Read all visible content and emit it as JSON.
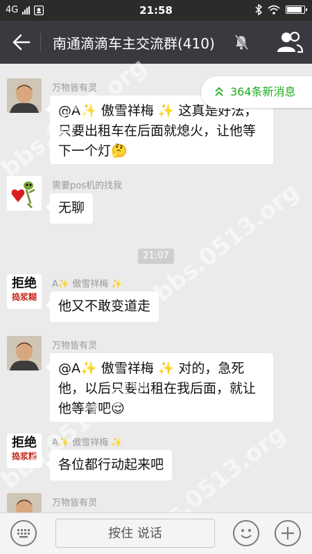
{
  "status_bar": {
    "network": "4G",
    "time": "21:58",
    "battery_level": 0.9
  },
  "header": {
    "title": "南通滴滴车主交流群(410)"
  },
  "new_messages": {
    "label": "364条新消息"
  },
  "messages": [
    {
      "sender": "万物皆有灵",
      "avatar": "man-photo",
      "text": "@A✨ 傲雪祥梅 ✨ 这真是好法，只要出租车在后面就熄火，让他等下一个灯🤔"
    },
    {
      "sender": "需要pos机的找我",
      "avatar": "rose-figure",
      "text": "无聊"
    },
    {
      "time_divider": "21:07"
    },
    {
      "sender": "A✨ 傲雪祥梅 ✨",
      "avatar": "reject-sticker",
      "text": "他又不敢变道走"
    },
    {
      "sender": "万物皆有灵",
      "avatar": "man-photo",
      "text": "@A✨ 傲雪祥梅 ✨ 对的，急死他，以后只要出租在我后面，就让他等着吧😌"
    },
    {
      "sender": "A✨ 傲雪祥梅 ✨",
      "avatar": "reject-sticker",
      "text": "各位都行动起来吧"
    },
    {
      "sender": "万物皆有灵",
      "avatar": "man-photo"
    }
  ],
  "avatar_text": {
    "reject_top": "拒绝",
    "reject_bottom": "捣浆糊"
  },
  "input_bar": {
    "hold_to_talk": "按住 说话"
  },
  "watermark": "bbs.0513.org",
  "colors": {
    "header_bg": "#393a3f",
    "chat_bg": "#ebebeb",
    "accent_green": "#1aad19"
  }
}
